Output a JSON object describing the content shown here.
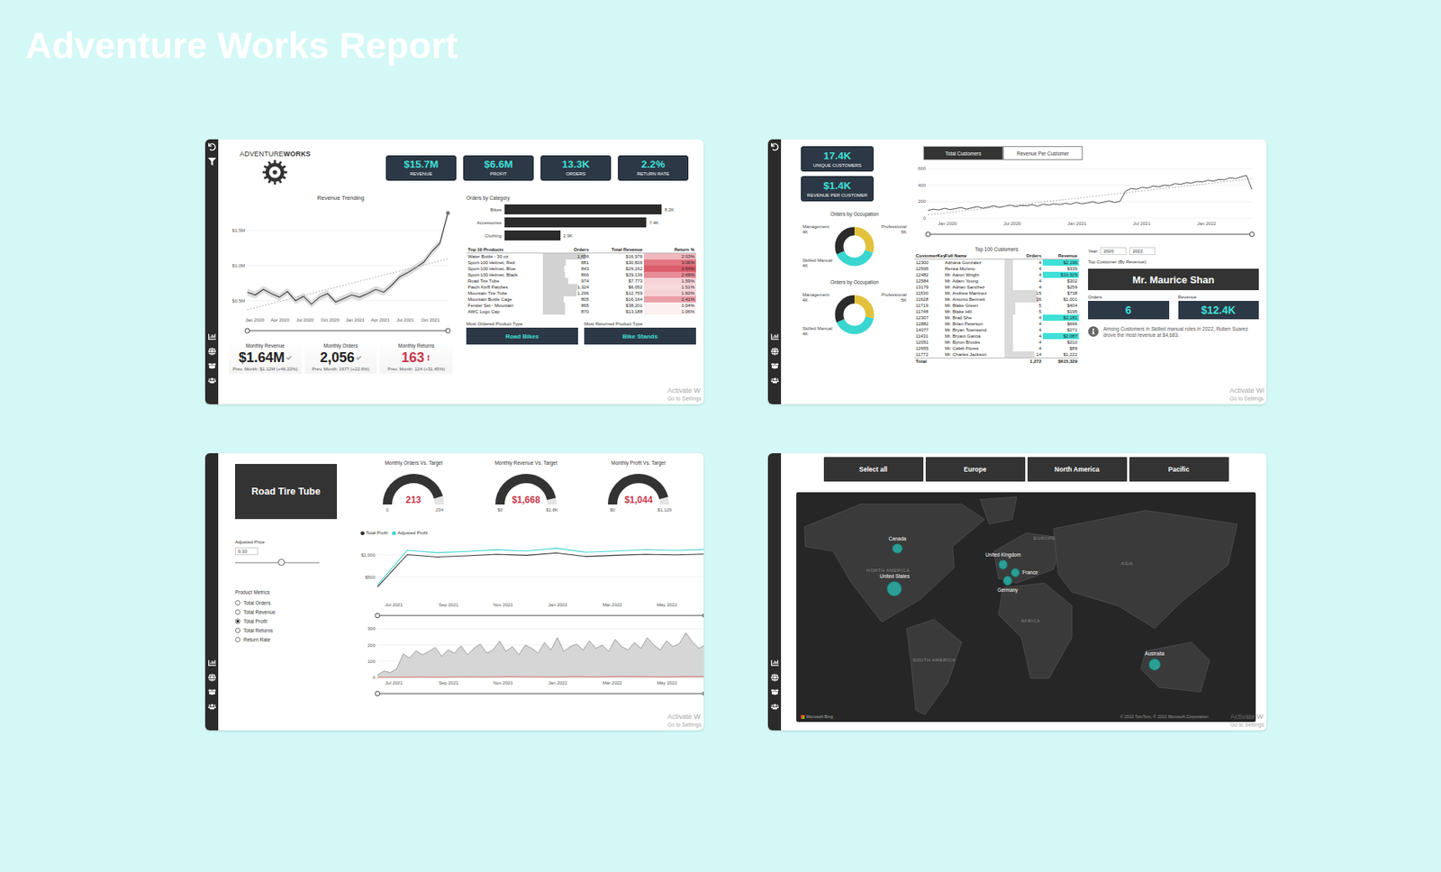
{
  "title": "Adventure Works Report",
  "overview": {
    "logo": {
      "light": "ADVENTURE",
      "bold": "WORKS"
    },
    "kpis": [
      {
        "value": "$15.7M",
        "label": "REVENUE"
      },
      {
        "value": "$6.6M",
        "label": "PROFIT"
      },
      {
        "value": "13.3K",
        "label": "ORDERS"
      },
      {
        "value": "2.2%",
        "label": "RETURN RATE"
      }
    ],
    "revenue_chart": {
      "title": "Revenue Trending",
      "y_min": 0.3,
      "y_max": 1.85,
      "y_ticks": [
        {
          "label": "$1.5M",
          "value": 1.5
        },
        {
          "label": "$1.0M",
          "value": 1.0
        },
        {
          "label": "$0.5M",
          "value": 0.5
        }
      ],
      "x_ticks": [
        "Jan 2020",
        "Apr 2020",
        "Jul 2020",
        "Oct 2020",
        "Jan 2021",
        "Apr 2021",
        "Jul 2021",
        "Oct 2021"
      ],
      "values": [
        0.62,
        0.58,
        0.66,
        0.6,
        0.55,
        0.63,
        0.5,
        0.56,
        0.45,
        0.55,
        0.6,
        0.48,
        0.53,
        0.58,
        0.55,
        0.6,
        0.66,
        0.62,
        0.72,
        0.84,
        0.9,
        0.97,
        1.05,
        1.2,
        1.32,
        1.75
      ],
      "range": {
        "low": 0,
        "high": 1
      }
    },
    "monthly": [
      {
        "label": "Monthly Revenue",
        "value": "$1.64M",
        "previous": "Prev. Month: $1.12M (+46.22%)",
        "alert": false
      },
      {
        "label": "Monthly Orders",
        "value": "2,056",
        "previous": "Prev. Month: 1677 (+22.6%)",
        "alert": false
      },
      {
        "label": "Monthly Returns",
        "value": "163",
        "previous": "Prev. Month: 124 (+31.45%)",
        "alert": true
      }
    ],
    "orders_by_category": {
      "title": "Orders by Category",
      "bars": [
        {
          "label": "Bikes",
          "value": 8.2,
          "text": "8.2K"
        },
        {
          "label": "Accessories",
          "value": 7.4,
          "text": "7.4K"
        },
        {
          "label": "Clothing",
          "value": 2.9,
          "text": "2.9K"
        }
      ]
    },
    "top_products": {
      "columns": [
        "Top 10 Products",
        "Orders",
        "Total Revenue",
        "Return %"
      ],
      "rows": [
        {
          "name": "Water Bottle - 30 oz.",
          "orders": "1,656",
          "revenue": "$16,976",
          "return_pct": "2.03%"
        },
        {
          "name": "Sport-100 Helmet, Red",
          "orders": "881",
          "revenue": "$30,826",
          "return_pct": "3.06%"
        },
        {
          "name": "Sport-100 Helmet, Blue",
          "orders": "843",
          "revenue": "$29,162",
          "return_pct": "3.54%"
        },
        {
          "name": "Sport-100 Helmet, Black",
          "orders": "866",
          "revenue": "$29,136",
          "return_pct": "2.69%"
        },
        {
          "name": "Road Tire Tube",
          "orders": "974",
          "revenue": "$7,773",
          "return_pct": "1.59%"
        },
        {
          "name": "Patch Kit/8 Patches",
          "orders": "1,324",
          "revenue": "$6,052",
          "return_pct": "1.51%"
        },
        {
          "name": "Mountain Tire Tube",
          "orders": "1,296",
          "revenue": "$12,759",
          "return_pct": "1.60%"
        },
        {
          "name": "Mountain Bottle Cage",
          "orders": "805",
          "revenue": "$16,164",
          "return_pct": "2.41%"
        },
        {
          "name": "Fender Set - Mountain",
          "orders": "865",
          "revenue": "$38,201",
          "return_pct": "1.04%"
        },
        {
          "name": "AWC Logo Cap",
          "orders": "870",
          "revenue": "$13,188",
          "return_pct": "1.06%"
        }
      ]
    },
    "product_types": [
      {
        "label": "Most Ordered Product Type",
        "value": "Road Bikes"
      },
      {
        "label": "Most Returned Product Type",
        "value": "Bike Stands"
      }
    ],
    "watermark": [
      "Activate W",
      "Go to Settings"
    ]
  },
  "customers": {
    "kpis": [
      {
        "value": "17.4K",
        "label": "UNIQUE CUSTOMERS"
      },
      {
        "value": "$1.4K",
        "label": "REVENUE PER CUSTOMER"
      }
    ],
    "toggle": [
      {
        "label": "Total Customers",
        "selected": true
      },
      {
        "label": "Revenue Per Customer",
        "selected": false
      }
    ],
    "chart": {
      "y_min": 0,
      "y_max": 650,
      "y_ticks": [
        {
          "label": "600",
          "value": 600
        },
        {
          "label": "400",
          "value": 400
        },
        {
          "label": "200",
          "value": 200
        },
        {
          "label": "0",
          "value": 0
        }
      ],
      "x_ticks": [
        "Jan 2020",
        "Jul 2020",
        "Jan 2021",
        "Jul 2021",
        "Jan 2022"
      ],
      "values": [
        95,
        110,
        100,
        120,
        105,
        115,
        130,
        110,
        125,
        140,
        120,
        135,
        150,
        130,
        145,
        160,
        140,
        155,
        150,
        165,
        145,
        170,
        160,
        175,
        165,
        180,
        170,
        190,
        175,
        185,
        200,
        180,
        195,
        210,
        190,
        205,
        330,
        360,
        350,
        375,
        365,
        390,
        380,
        400,
        395,
        420,
        410,
        430,
        425,
        445,
        440,
        460,
        450,
        470,
        465,
        490,
        480,
        500,
        520,
        350
      ],
      "range": {
        "low": 0,
        "high": 1
      }
    },
    "donuts": [
      {
        "title": "Orders by Occupation",
        "segments": [
          {
            "label": "Management",
            "value": "4K",
            "level": 0.3,
            "color": "#e2c13c"
          },
          {
            "label": "Professional",
            "value": "5K",
            "level": 0.38,
            "color": "#3ad6d0"
          },
          {
            "label": "Skilled Manual",
            "value": "4K",
            "level": 0.32,
            "color": "#2b2b2b"
          }
        ]
      },
      {
        "title": "Orders by Occupation",
        "segments": [
          {
            "label": "Management",
            "value": "4K",
            "level": 0.28,
            "color": "#e2c13c"
          },
          {
            "label": "Professional",
            "value": "5K",
            "level": 0.4,
            "color": "#3ad6d0"
          },
          {
            "label": "Skilled Manual",
            "value": "4K",
            "level": 0.32,
            "color": "#2b2b2b"
          }
        ]
      }
    ],
    "table": {
      "title": "Top 100 Customers",
      "columns": [
        "CustomerKey",
        "Full Name",
        "Orders",
        "Revenue"
      ],
      "rows": [
        {
          "key": "12300",
          "name": "Adriana Gonzalez",
          "orders": "4",
          "revenue": "$2,196"
        },
        {
          "key": "12595",
          "name": "Renea Moreno",
          "orders": "4",
          "revenue": "$335"
        },
        {
          "key": "12482",
          "name": "Mr. Aaron Wright",
          "orders": "4",
          "revenue": "$10,329"
        },
        {
          "key": "12584",
          "name": "Mr. Adam Young",
          "orders": "4",
          "revenue": "$302"
        },
        {
          "key": "13179",
          "name": "Mr. Adrian Sanchez",
          "orders": "4",
          "revenue": "$259"
        },
        {
          "key": "11530",
          "name": "Mr. Andrew Martinez",
          "orders": "15",
          "revenue": "$738"
        },
        {
          "key": "11628",
          "name": "Mr. Antonio Bennett",
          "orders": "16",
          "revenue": "$1,001"
        },
        {
          "key": "11719",
          "name": "Mr. Blake Green",
          "orders": "5",
          "revenue": "$404"
        },
        {
          "key": "11748",
          "name": "Mr. Blake Hill",
          "orders": "5",
          "revenue": "$195"
        },
        {
          "key": "12307",
          "name": "Mr. Brad She",
          "orders": "4",
          "revenue": "$2,181"
        },
        {
          "key": "12882",
          "name": "Mr. Brian Peterson",
          "orders": "4",
          "revenue": "$696"
        },
        {
          "key": "14077",
          "name": "Mr. Bryan Townsend",
          "orders": "4",
          "revenue": "$271"
        },
        {
          "key": "11431",
          "name": "Mr. Bryant Garcia",
          "orders": "4",
          "revenue": "$2,087"
        },
        {
          "key": "12051",
          "name": "Mr. Byron Brooks",
          "orders": "4",
          "revenue": "$210"
        },
        {
          "key": "12655",
          "name": "Mr. Caleb Flores",
          "orders": "4",
          "revenue": "$89"
        },
        {
          "key": "11772",
          "name": "Mr. Charles Jackson",
          "orders": "14",
          "revenue": "$1,222"
        }
      ],
      "total": {
        "label": "Total",
        "orders": "1,272",
        "revenue": "$615,329"
      }
    },
    "year": {
      "label": "Year",
      "from": "2020",
      "to": "2022"
    },
    "top_customer": {
      "label": "Top Customer (By Revenue):",
      "name": "Mr. Maurice Shan",
      "orders_label": "Orders",
      "orders": "6",
      "revenue_label": "Revenue",
      "revenue": "$12.4K"
    },
    "insight": "Among Customers in Skilled manual roles in 2022, Ruben Suarez drove the most revenue at $4,683.",
    "watermark": [
      "Activate Wi",
      "Go to Settings"
    ]
  },
  "product": {
    "name": "Road Tire Tube",
    "gauges": [
      {
        "title": "Monthly Orders Vs. Target",
        "value": "213",
        "min": "0",
        "max": "234",
        "level": 0.91
      },
      {
        "title": "Monthly Revenue Vs. Target",
        "value": "$1,668",
        "min": "$0",
        "max": "$1.8K",
        "level": 0.93
      },
      {
        "title": "Monthly Profit Vs. Target",
        "value": "$1,044",
        "min": "$0",
        "max": "$1,129",
        "level": 0.92
      }
    ],
    "adjusted_price": {
      "label": "Adjusted Price",
      "value": "0.10",
      "level": 0.55
    },
    "metrics": {
      "title": "Product Metrics",
      "options": [
        {
          "label": "Total Orders",
          "selected": false
        },
        {
          "label": "Total Revenue",
          "selected": false
        },
        {
          "label": "Total Profit",
          "selected": true
        },
        {
          "label": "Total Returns",
          "selected": false
        },
        {
          "label": "Return Rate",
          "selected": false
        }
      ]
    },
    "profit_chart": {
      "legend": [
        {
          "label": "Total Profit",
          "color": "#333333"
        },
        {
          "label": "Adjusted Profit",
          "color": "#3ad6d0"
        }
      ],
      "y_min": 0,
      "y_max": 1300,
      "y_ticks": [
        {
          "label": "$1,000",
          "value": 1000
        },
        {
          "label": "$500",
          "value": 500
        }
      ],
      "x_ticks": [
        "Jul 2021",
        "Sep 2021",
        "Nov 2021",
        "Jan 2022",
        "Mar 2022",
        "May 2022"
      ],
      "series": [
        [
          280,
          1000,
          950,
          975,
          1010,
          985,
          1040,
          960,
          985,
          1010,
          995,
          1015
        ],
        [
          320,
          1100,
          1045,
          1072,
          1110,
          1083,
          1144,
          1056,
          1083,
          1111,
          1094,
          1116
        ]
      ],
      "range": {
        "low": 0,
        "high": 1
      }
    },
    "orders_chart": {
      "y_min": 0,
      "y_max": 320,
      "y_ticks": [
        {
          "label": "300",
          "value": 300
        },
        {
          "label": "200",
          "value": 200
        },
        {
          "label": "100",
          "value": 100
        },
        {
          "label": "0",
          "value": 0
        }
      ],
      "x_ticks": [
        "Jul 2021",
        "Sep 2021",
        "Nov 2021",
        "Jan 2022",
        "Mar 2022",
        "May 2022"
      ],
      "values": [
        15,
        40,
        30,
        55,
        145,
        120,
        165,
        140,
        160,
        185,
        130,
        170,
        150,
        195,
        140,
        180,
        205,
        150,
        170,
        225,
        160,
        190,
        140,
        200,
        180,
        150,
        215,
        170,
        245,
        160,
        190,
        205,
        170,
        225,
        180,
        200,
        160,
        235,
        190,
        170,
        215,
        180,
        245,
        200,
        170,
        225,
        190,
        210,
        275,
        220,
        180,
        200
      ],
      "returns": [
        1,
        2,
        3,
        2,
        4,
        3,
        5,
        4,
        3,
        5,
        4,
        6,
        5,
        4,
        5,
        6
      ],
      "range": {
        "low": 0,
        "high": 1
      }
    },
    "watermark": [
      "Activate W",
      "Go to Settings"
    ]
  },
  "map": {
    "buttons": [
      {
        "label": "Select all",
        "selected": false
      },
      {
        "label": "Europe",
        "selected": false
      },
      {
        "label": "North America",
        "selected": false
      },
      {
        "label": "Pacific",
        "selected": false
      }
    ],
    "regions": [
      "NORTH AMERICA",
      "EUROPE",
      "AFRICA",
      "ASIA",
      "SOUTH AMERICA"
    ],
    "countries": [
      {
        "name": "Canada",
        "level": 0.45
      },
      {
        "name": "United States",
        "level": 1
      },
      {
        "name": "United Kingdom",
        "level": 0.4
      },
      {
        "name": "France",
        "level": 0.35
      },
      {
        "name": "Germany",
        "level": 0.35
      },
      {
        "name": "Australia",
        "level": 0.7
      }
    ],
    "attribution": "Microsoft Bing",
    "copyright": "© 2022 TomTom, © 2022 Microsoft Corporation",
    "watermark": [
      "Activate W",
      "Go to Settings"
    ]
  }
}
